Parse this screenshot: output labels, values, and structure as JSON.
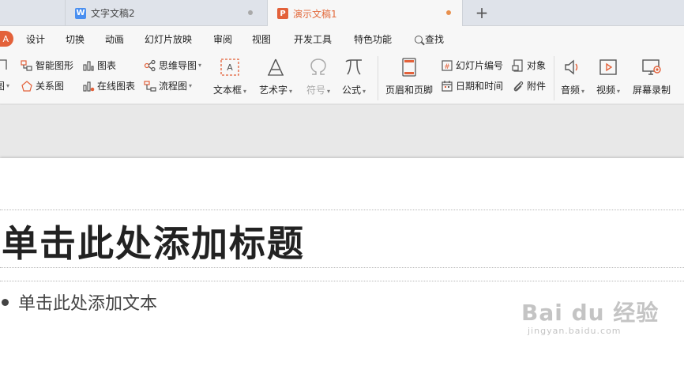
{
  "tabs": [
    {
      "title": "文字文稿2",
      "icon_letter": "W",
      "active": false
    },
    {
      "title": "演示文稿1",
      "icon_letter": "P",
      "active": true
    }
  ],
  "new_tab_label": "+",
  "start_label": "A",
  "menu": [
    "设计",
    "切换",
    "动画",
    "幻灯片放映",
    "审阅",
    "视图",
    "开发工具",
    "特色功能"
  ],
  "menu_search": "查找",
  "ribbon": {
    "left_cut_top": "",
    "left_cut_bottom": "图",
    "smartart": "智能图形",
    "chart": "图表",
    "mindmap": "思维导图",
    "relation": "关系图",
    "online_chart": "在线图表",
    "flowchart": "流程图",
    "textbox": "文本框",
    "wordart": "艺术字",
    "symbol": "符号",
    "formula": "公式",
    "header_footer": "页眉和页脚",
    "slide_number": "幻灯片编号",
    "object": "对象",
    "datetime": "日期和时间",
    "attachment": "附件",
    "audio": "音频",
    "video": "视频",
    "screen_record": "屏幕录制",
    "cut_right": "F"
  },
  "slide": {
    "title_placeholder": "单击此处添加标题",
    "body_placeholder": "单击此处添加文本"
  },
  "watermark": {
    "brand": "Bai du 经验",
    "url": "jingyan.baidu.com"
  },
  "colors": {
    "accent": "#e3613a",
    "writer_blue": "#4a8ff0"
  }
}
